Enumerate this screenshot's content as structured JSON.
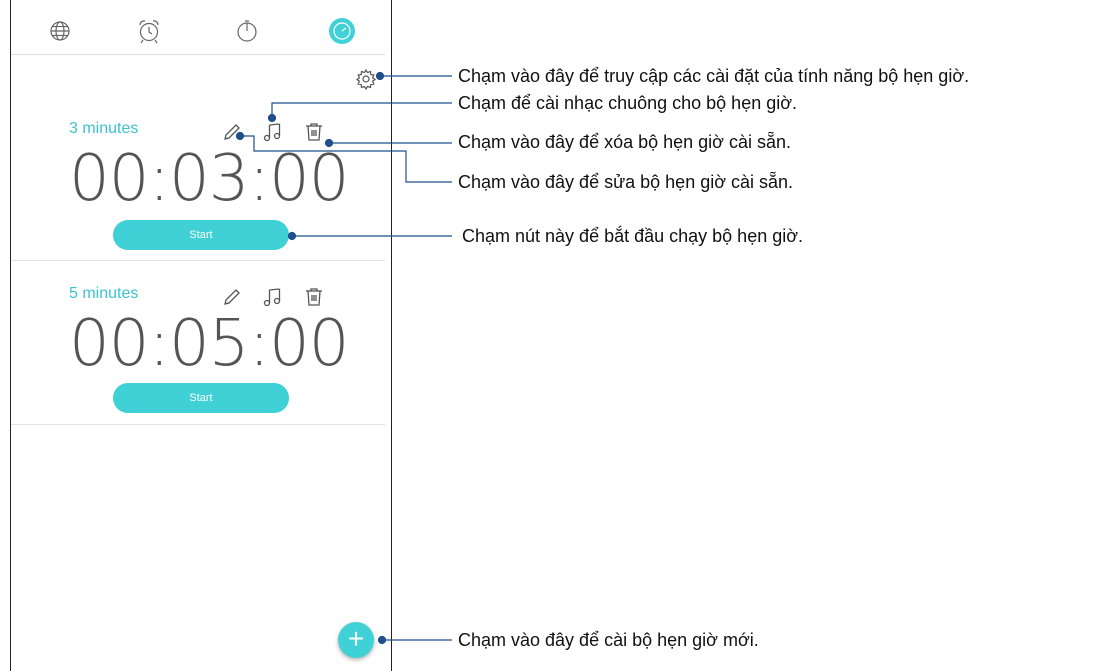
{
  "tabs": [
    {
      "name": "world-clock",
      "icon": "globe-icon"
    },
    {
      "name": "alarm",
      "icon": "alarm-clock-icon"
    },
    {
      "name": "stopwatch",
      "icon": "stopwatch-icon"
    },
    {
      "name": "timer",
      "icon": "timer-icon",
      "active": true
    }
  ],
  "timers": [
    {
      "label": "3 minutes",
      "time": "00:03:00",
      "start_label": "Start"
    },
    {
      "label": "5 minutes",
      "time": "00:05:00",
      "start_label": "Start"
    }
  ],
  "annotations": {
    "settings": "Chạm vào đây để truy cập các cài đặt của tính năng bộ hẹn giờ.",
    "ringtone": "Chạm để cài nhạc chuông cho bộ hẹn giờ.",
    "delete": "Chạm vào đây để xóa bộ hẹn giờ cài sẵn.",
    "edit": "Chạm vào đây để sửa bộ hẹn giờ cài sẵn.",
    "start": "Chạm nút này để bắt đầu chạy  bộ hẹn giờ.",
    "add": "Chạm vào đây để cài bộ hẹn giờ mới."
  },
  "colors": {
    "accent": "#3fd1d6",
    "label": "#3cc3cd",
    "callout": "#1f4f8c"
  }
}
